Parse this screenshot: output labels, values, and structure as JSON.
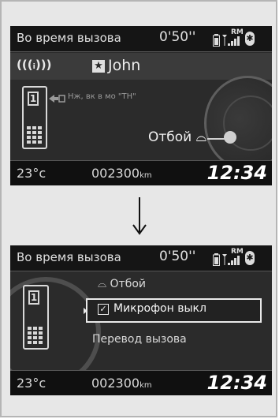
{
  "screen_top": {
    "header": {
      "title": "Во время вызова",
      "timer": "0'50''",
      "roaming": "RM",
      "bluetooth_glyph": "✱"
    },
    "caller_row": {
      "call_wave": "(((ᵢ)))",
      "favorite_glyph": "★",
      "caller_name": "John"
    },
    "phone_line": "1",
    "transfer_text": "Нж, вк в мо \"ТН\"",
    "hangup_label": "Отбой",
    "hangup_glyph": "⌓"
  },
  "screen_bottom": {
    "header": {
      "title": "Во время вызова",
      "timer": "0'50''",
      "roaming": "RM",
      "bluetooth_glyph": "✱"
    },
    "phone_line": "1",
    "menu": {
      "items": [
        {
          "label": "Отбой",
          "glyph": "⌓"
        },
        {
          "label": "Микрофон выкл",
          "glyph": "✓",
          "selected": true,
          "checked": true
        },
        {
          "label": "Перевод вызова"
        }
      ]
    }
  },
  "status_bar": {
    "temperature": "23°c",
    "odometer": "002300",
    "odometer_unit": "km",
    "clock": "12:34"
  },
  "colors": {
    "screen_bg": "#2b2b2b",
    "header_bg": "#151515",
    "panel_bg": "#e7e7e7",
    "text": "#e6e6e6"
  },
  "icons": [
    "battery-icon",
    "signal-icon",
    "bluetooth-icon",
    "phone-icon",
    "transfer-icon",
    "hangup-icon",
    "check-icon",
    "down-arrow-icon"
  ]
}
